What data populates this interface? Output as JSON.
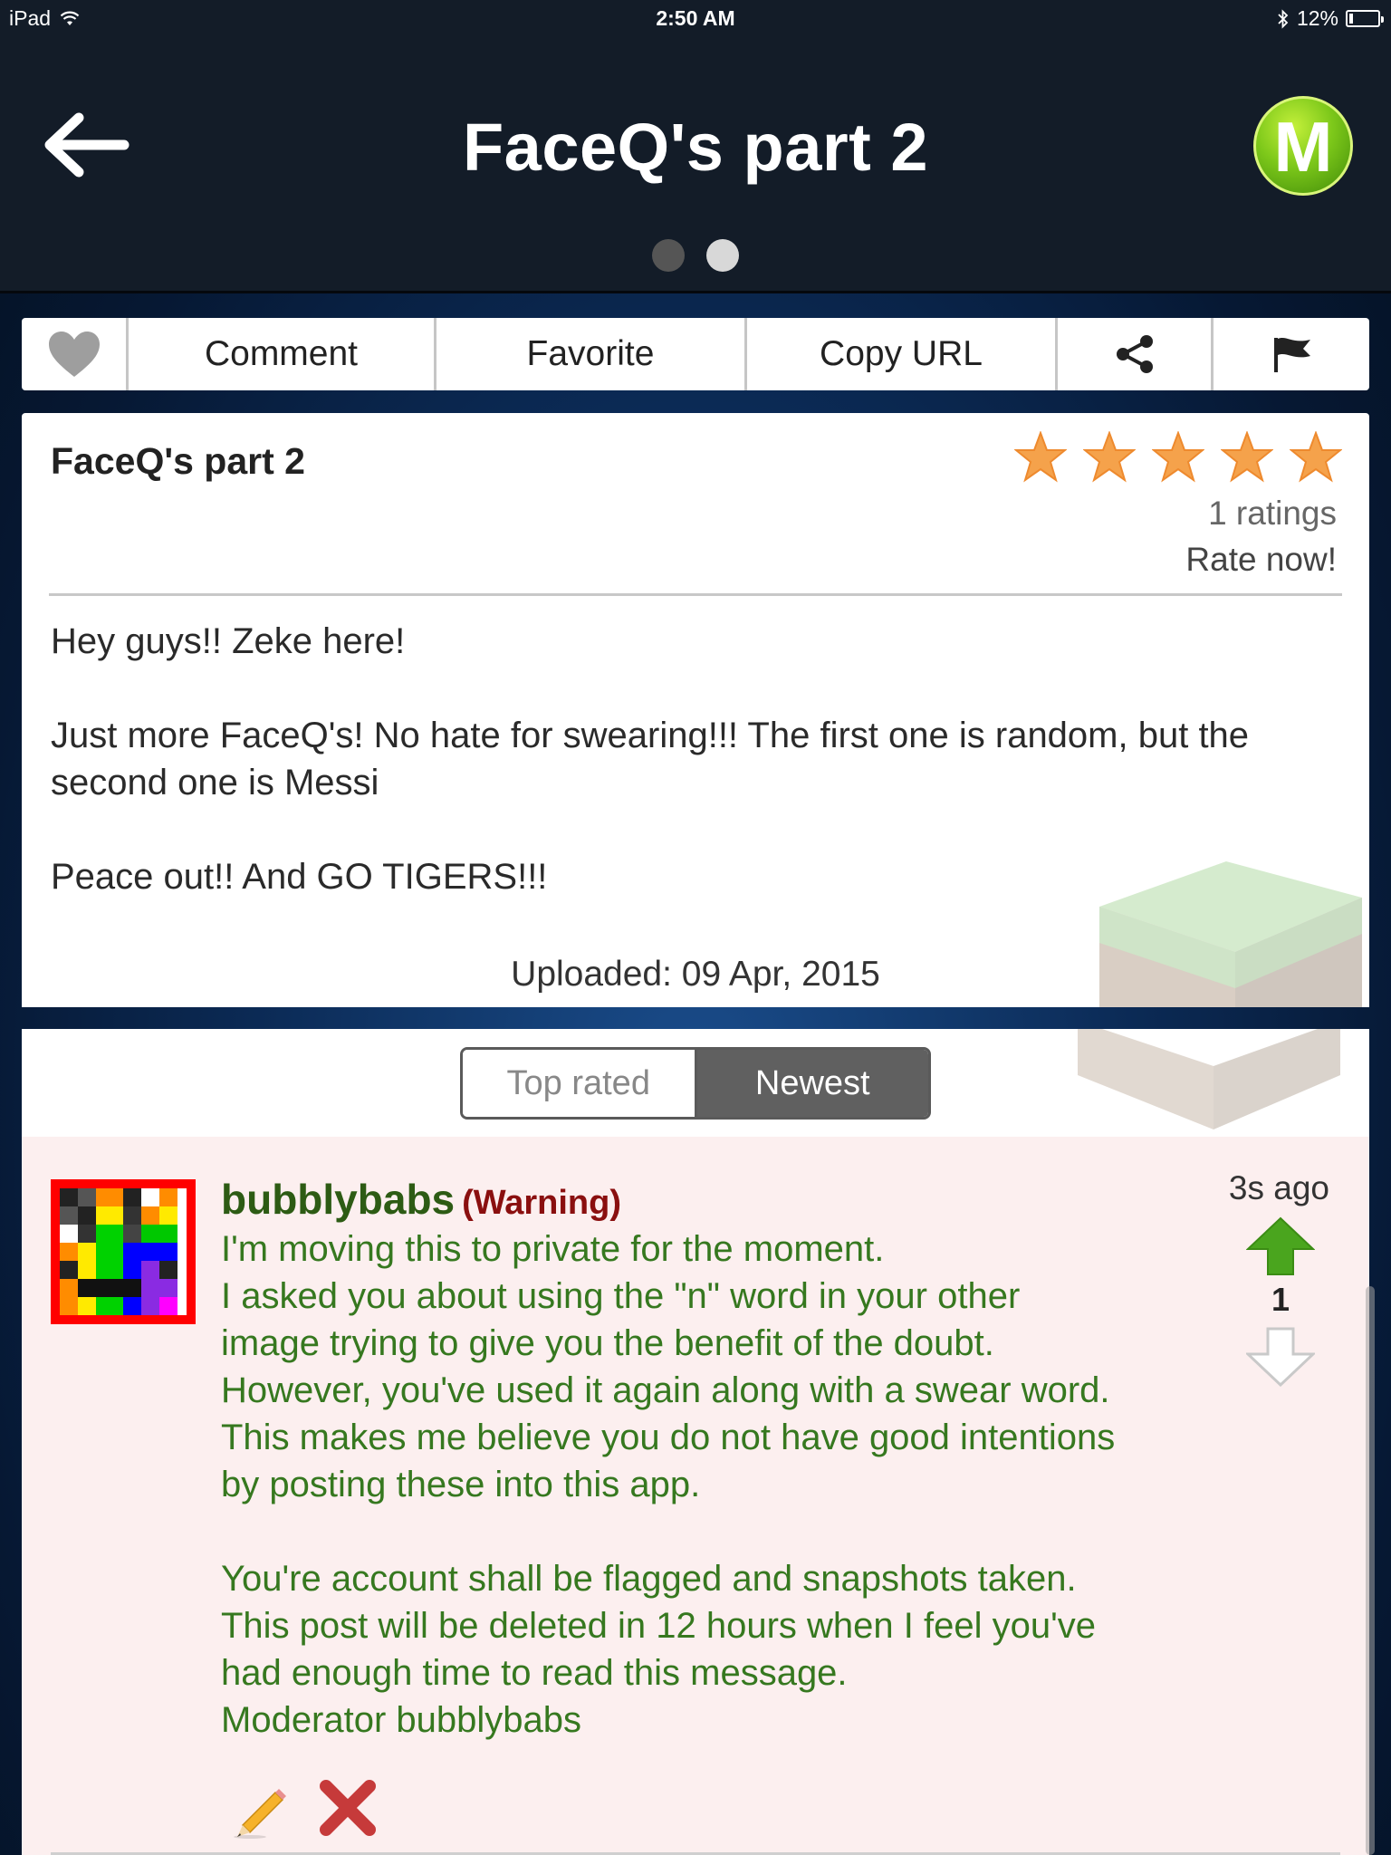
{
  "status_bar": {
    "device": "iPad",
    "time": "2:50 AM",
    "battery": "12%"
  },
  "header": {
    "title": "FaceQ's part 2",
    "logo_letter": "M",
    "pager": {
      "pages": 2,
      "active": 2
    }
  },
  "toolbar": {
    "comment": "Comment",
    "favorite": "Favorite",
    "copy_url": "Copy URL"
  },
  "post": {
    "title": "FaceQ's part 2",
    "rating_stars": 5,
    "ratings": "1 ratings",
    "rate_now": "Rate now!",
    "description": [
      "Hey guys!! Zeke here!",
      "Just more FaceQ's! No hate for swearing!!! The first one is random, but the second one is Messi",
      "Peace out!! And GO TIGERS!!!"
    ],
    "uploaded": "Uploaded: 09 Apr, 2015"
  },
  "comments": {
    "sort": {
      "top_rated": "Top rated",
      "newest": "Newest",
      "selected": "newest"
    },
    "items": [
      {
        "username": "bubblybabs",
        "tag": "(Warning)",
        "time": "3s ago",
        "votes": "1",
        "lines": [
          "I'm moving this to private for the moment.",
          "I asked you about using the \"n\" word in your other",
          "image trying to give you the benefit of the doubt.",
          "However, you've used it again along with a swear word.",
          "This makes me believe you do not have good intentions",
          "by posting these into this app.",
          "",
          "You're account shall be flagged and snapshots taken.",
          "This post will be deleted in 12 hours when I feel you've",
          "had enough time to read this message.",
          "Moderator bubblybabs"
        ]
      }
    ]
  },
  "colors": {
    "header_bg": "#131c28",
    "comment_bg": "#fcefef",
    "username": "#2d5b14",
    "warning": "#8a0f0f",
    "comment_text": "#36781f",
    "upvote": "#4aa51e"
  },
  "icons": [
    "wifi-icon",
    "bluetooth-icon",
    "battery-icon",
    "back-arrow-icon",
    "heart-icon",
    "share-icon",
    "flag-icon",
    "star-icon",
    "upvote-arrow-icon",
    "downvote-arrow-icon",
    "pencil-icon",
    "delete-x-icon"
  ]
}
